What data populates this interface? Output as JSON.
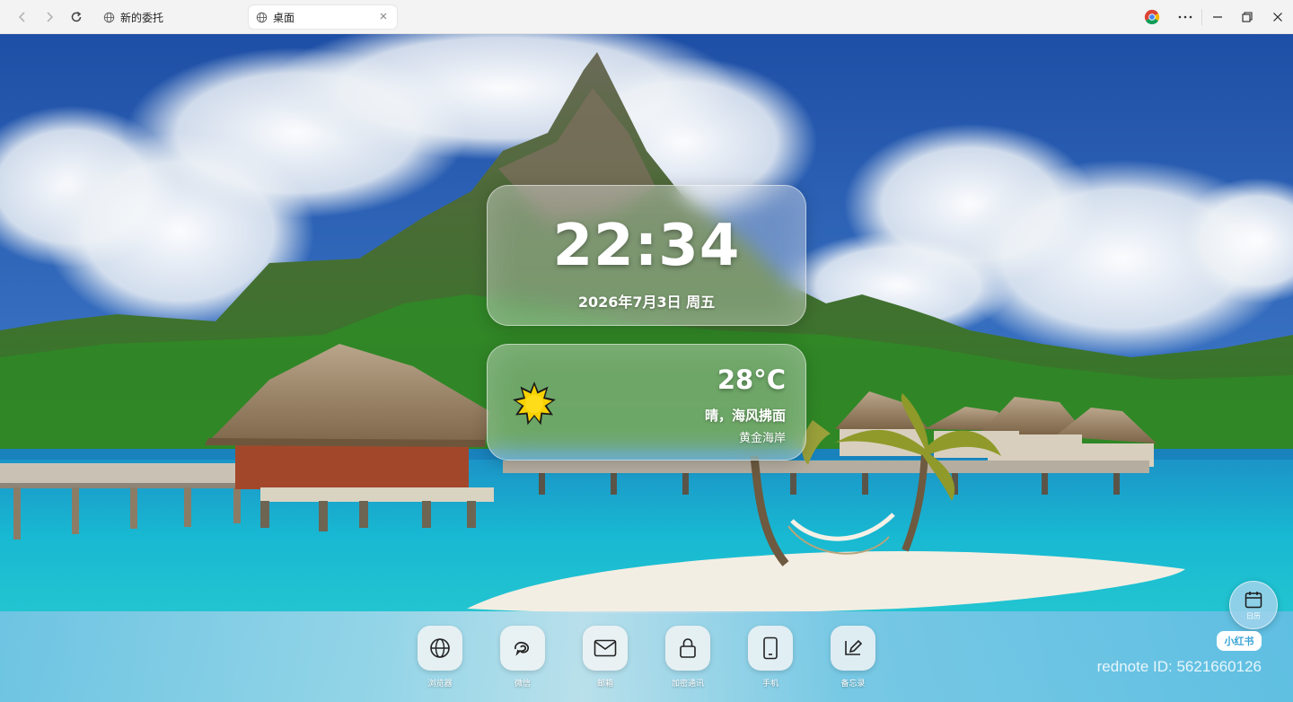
{
  "browser": {
    "tabs": [
      {
        "title": "新的委托",
        "active": false
      },
      {
        "title": "桌面",
        "active": true
      }
    ]
  },
  "clock": {
    "time": "22:34",
    "date": "2026年7月3日 周五"
  },
  "weather": {
    "temperature": "28°C",
    "condition": "晴，海风拂面",
    "location": "黄金海岸",
    "icon": "sun-icon"
  },
  "dock": {
    "items": [
      {
        "label": "浏览器",
        "icon": "globe-icon"
      },
      {
        "label": "微信",
        "icon": "wechat-icon"
      },
      {
        "label": "邮箱",
        "icon": "mail-icon"
      },
      {
        "label": "加密通讯",
        "icon": "lock-icon"
      },
      {
        "label": "手机",
        "icon": "phone-icon"
      },
      {
        "label": "备忘录",
        "icon": "memo-edit-icon"
      }
    ]
  },
  "calendar": {
    "label": "日历",
    "icon": "calendar-icon"
  },
  "watermark": {
    "logo_text": "小红书",
    "id_text": "rednote ID: 5621660126"
  },
  "colors": {
    "chrome_bg": "#f3f3f3",
    "sky": "#2a64b8",
    "sea": "#18b7cf",
    "dock": "#7cc6e6"
  }
}
